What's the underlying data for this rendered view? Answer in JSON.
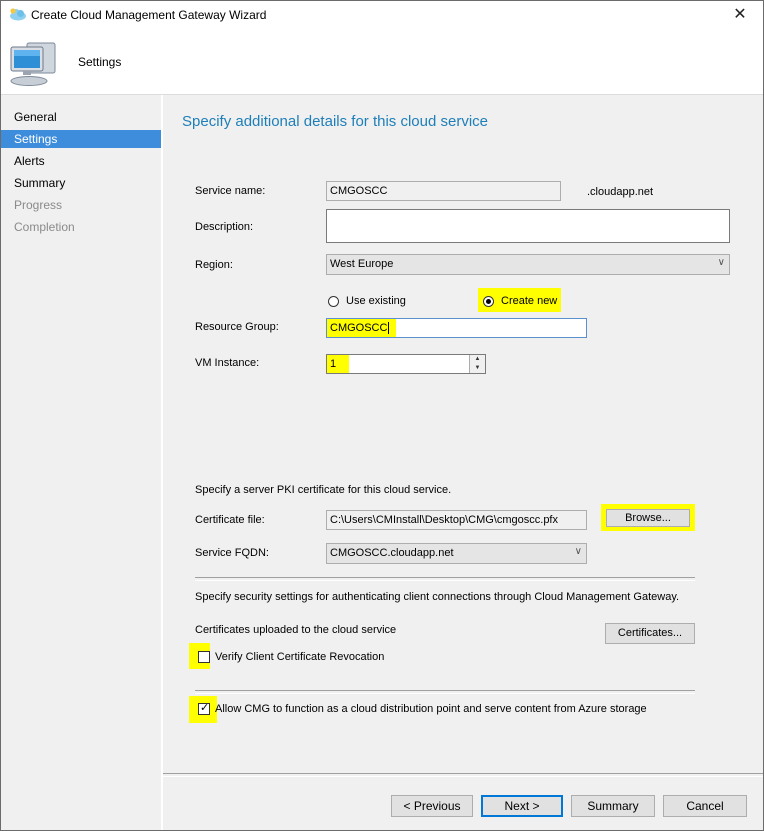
{
  "window": {
    "title": "Create Cloud Management Gateway Wizard",
    "close_glyph": "✕"
  },
  "header": {
    "title": "Settings",
    "icon": "computer-icon"
  },
  "nav": {
    "items": [
      {
        "label": "General",
        "state": "normal"
      },
      {
        "label": "Settings",
        "state": "active"
      },
      {
        "label": "Alerts",
        "state": "normal"
      },
      {
        "label": "Summary",
        "state": "normal"
      },
      {
        "label": "Progress",
        "state": "disabled"
      },
      {
        "label": "Completion",
        "state": "disabled"
      }
    ]
  },
  "form": {
    "heading": "Specify additional details for this cloud service",
    "service_name_label": "Service name:",
    "service_name_value": "CMGOSCC",
    "service_name_suffix": ".cloudapp.net",
    "description_label": "Description:",
    "description_value": "",
    "region_label": "Region:",
    "region_value": "West Europe",
    "use_existing_label": "Use existing",
    "create_new_label": "Create new",
    "resource_group_label": "Resource Group:",
    "resource_group_value": "CMGOSCC",
    "vm_instance_label": "VM Instance:",
    "vm_instance_value": "1",
    "pki_text": "Specify a server PKI certificate for this cloud service.",
    "certificate_file_label": "Certificate file:",
    "certificate_file_value": "C:\\Users\\CMInstall\\Desktop\\CMG\\cmgoscc.pfx",
    "browse_label": "Browse...",
    "service_fqdn_label": "Service FQDN:",
    "service_fqdn_value": "CMGOSCC.cloudapp.net",
    "security_text": "Specify security settings for authenticating client connections through Cloud Management Gateway.",
    "certs_uploaded_label": "Certificates uploaded to the cloud service",
    "certificates_button": "Certificates...",
    "verify_revocation_label": "Verify Client Certificate Revocation",
    "verify_revocation_checked": false,
    "allow_cdp_label": "Allow CMG to function as a cloud distribution point and serve content from Azure storage",
    "allow_cdp_checked": true
  },
  "buttons": {
    "previous": "< Previous",
    "next": "Next >",
    "summary": "Summary",
    "cancel": "Cancel"
  },
  "colors": {
    "accent": "#3e8ddd",
    "heading": "#1e7fb8",
    "highlight": "#ffff00"
  }
}
